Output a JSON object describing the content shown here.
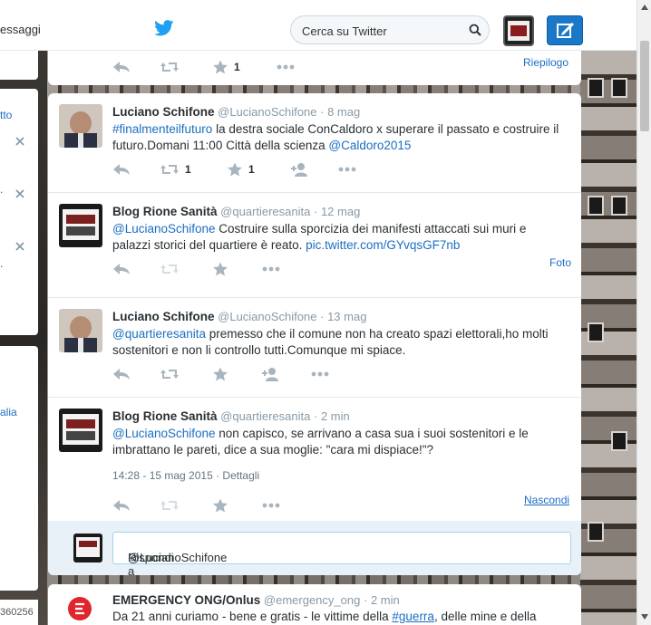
{
  "nav": {
    "messages_label": "essaggi"
  },
  "search": {
    "placeholder": "Cerca su Twitter"
  },
  "sidebar": {
    "link_top": "tto",
    "dot_1": ".",
    "dot_2": ".",
    "link_mid": "alia",
    "bottom_text": "360256"
  },
  "timeline_top": {
    "favorite_count": "1",
    "summary_link": "Riepilogo"
  },
  "tweets": [
    {
      "name": "Luciano Schifone",
      "handle": "@LucianoSchifone",
      "separator": "·",
      "time": "8 mag",
      "hashtag": "#finalmenteilfuturo",
      "text_part1": " la destra sociale ConCaldoro x superare il passato e costruire il futuro.Domani 11:00 Città della scienza ",
      "mention": "@Caldoro2015",
      "retweet_count": "1",
      "favorite_count": "1"
    },
    {
      "name": "Blog Rione Sanità",
      "handle": "@quartieresanita",
      "separator": "·",
      "time": "12 mag",
      "mention": "@LucianoSchifone",
      "text_part1": " Costruire sulla sporcizia dei manifesti attaccati sui muri e palazzi storici del quartiere è reato. ",
      "pic_link": "pic.twitter.com/GYvqsGF7nb",
      "photo_link": "Foto"
    },
    {
      "name": "Luciano Schifone",
      "handle": "@LucianoSchifone",
      "separator": "·",
      "time": "13 mag",
      "mention": "@quartieresanita",
      "text_part1": " premesso che il comune non ha creato spazi elettorali,ho molti sostenitori e non li controllo tutti.Comunque mi spiace."
    },
    {
      "name": "Blog Rione Sanità",
      "handle": "@quartieresanita",
      "separator": "·",
      "time": "2 min",
      "mention": "@LucianoSchifone",
      "text_part1": " non capisco, se arrivano a casa sua i suoi sostenitori e le imbrattano le pareti, dice a sua moglie: \"cara mi dispiace!\"?",
      "timestamp": "14:28 - 15 mag 2015",
      "meta_sep": " · ",
      "details_link": "Dettagli",
      "hide_link": "Nascondi"
    }
  ],
  "reply": {
    "prefix": "Rispondi a ",
    "mention": "@LucianoSchifone"
  },
  "bottom_tweet": {
    "name": "EMERGENCY ONG/Onlus",
    "handle": "@emergency_ong",
    "separator": "·",
    "time": "2 min",
    "text_part1": "Da 21 anni curiamo - bene e gratis - le vittime della ",
    "hashtag": "#guerra",
    "text_part2": ", delle mine e della"
  },
  "colors": {
    "link": "#1b6ec2",
    "compose_button": "#1b78c9",
    "twitter_bird": "#1da1f2",
    "reply_bg": "#e8f1f8"
  },
  "icons": [
    "twitter-bird-icon",
    "search-icon",
    "compose-icon",
    "reply-icon",
    "retweet-icon",
    "favorite-icon",
    "follow-icon",
    "more-icon",
    "close-icon"
  ]
}
